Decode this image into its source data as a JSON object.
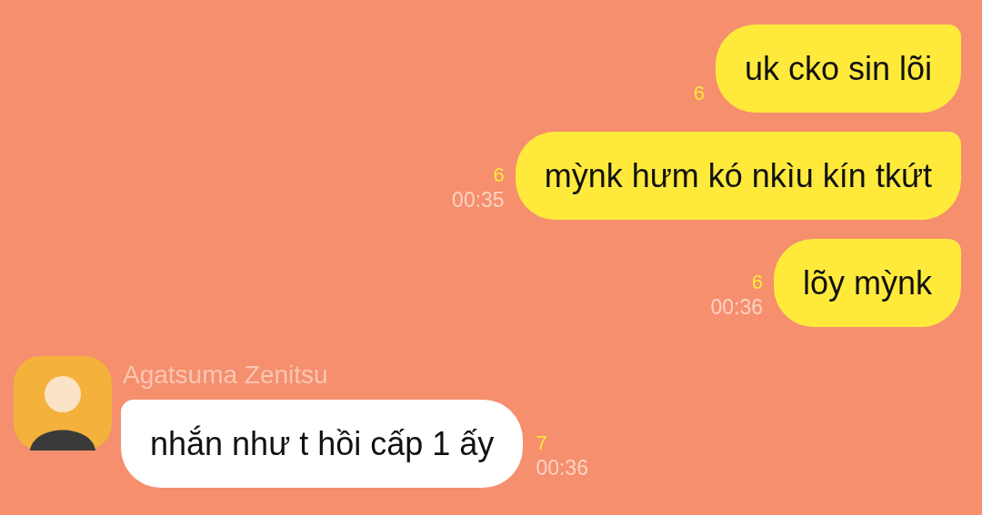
{
  "messages": [
    {
      "kind": "outgoing",
      "text": "uk cko sin lõi",
      "read_count": "6"
    },
    {
      "kind": "outgoing",
      "text": "mỳnk hưm kó nkìu kín tkứt",
      "read_count": "6",
      "time": "00:35"
    },
    {
      "kind": "outgoing",
      "text": "lõy mỳnk",
      "read_count": "6",
      "time": "00:36"
    },
    {
      "kind": "incoming",
      "sender": "Agatsuma Zenitsu",
      "text": "nhắn như t hồi cấp 1 ấy",
      "read_count": "7",
      "time": "00:36"
    }
  ]
}
